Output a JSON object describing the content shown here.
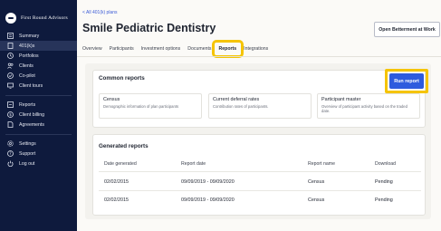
{
  "brand": {
    "name": "First Round Advisors"
  },
  "sidebar": {
    "items": [
      {
        "label": "Summary",
        "icon": "summary-icon"
      },
      {
        "label": "401(k)s",
        "icon": "doc-icon"
      },
      {
        "label": "Portfolios",
        "icon": "clock-icon"
      },
      {
        "label": "Clients",
        "icon": "users-icon"
      },
      {
        "label": "Co-pilot",
        "icon": "check-circle-icon"
      },
      {
        "label": "Client tours",
        "icon": "monitor-icon"
      },
      {
        "label": "Reports",
        "icon": "reports-icon"
      },
      {
        "label": "Client billing",
        "icon": "dollar-icon"
      },
      {
        "label": "Agreements",
        "icon": "document-icon"
      },
      {
        "label": "Settings",
        "icon": "gear-icon"
      },
      {
        "label": "Support",
        "icon": "help-icon"
      },
      {
        "label": "Log out",
        "icon": "power-icon"
      }
    ]
  },
  "header": {
    "breadcrumb": "< All 401(k) plans",
    "title": "Smile Pediatric Dentistry",
    "open_button": "Open Betterment at Work"
  },
  "tabs": [
    "Overview",
    "Participants",
    "Investment options",
    "Documents",
    "Reports",
    "Integrations"
  ],
  "common_reports": {
    "title": "Common reports",
    "run_button": "Run report",
    "reports": [
      {
        "name": "Census",
        "desc": "Demographic information of plan participants"
      },
      {
        "name": "Current deferral rates",
        "desc": "Contribution rates of participants."
      },
      {
        "name": "Participant master",
        "desc": "Overview of participant activity based on the traded date."
      }
    ]
  },
  "generated_reports": {
    "title": "Generated reports",
    "columns": [
      "Date generated",
      "Report date",
      "Report name",
      "Download"
    ],
    "rows": [
      [
        "02/02/2015",
        "09/09/2019 - 09/09/2020",
        "Census",
        "Pending"
      ],
      [
        "02/02/2015",
        "09/09/2019 - 09/09/2020",
        "Census",
        "Pending"
      ]
    ]
  },
  "colors": {
    "sidebar": "#0e1a3d",
    "accent": "#2e5bde",
    "highlight": "#f5c400"
  }
}
